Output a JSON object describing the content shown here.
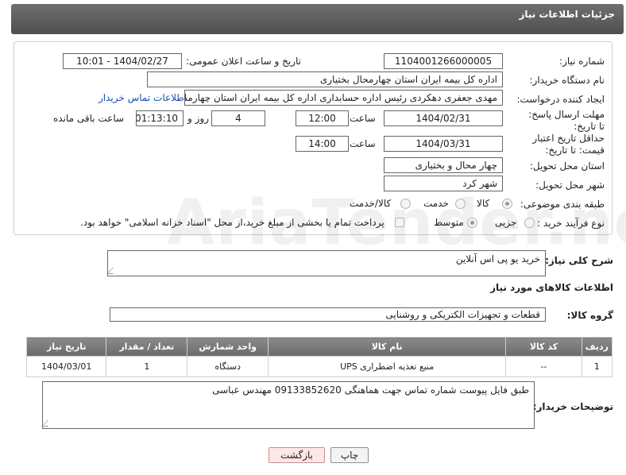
{
  "header": {
    "title": "جزئیات اطلاعات نیاز"
  },
  "form": {
    "need_number": {
      "label": "شماره نیاز:",
      "value": "1104001266000005"
    },
    "announce_datetime": {
      "label": "تاریخ و ساعت اعلان عمومی:",
      "value": "1404/02/27 - 10:01"
    },
    "buyer_org": {
      "label": "نام دستگاه خریدار:",
      "value": "اداره کل بیمه ایران استان چهارمحال بختیاری"
    },
    "requester": {
      "label": "ایجاد کننده درخواست:",
      "value": "مهدی جعفری دهکردی رئیس اداره حسابداری اداره کل بیمه ایران استان چهارمحال",
      "contact_link": "اطلاعات تماس خریدار"
    },
    "reply_deadline": {
      "label": "مهلت ارسال پاسخ: تا تاریخ:",
      "date": "1404/02/31",
      "time_label": "ساعت",
      "time": "12:00",
      "days": "4",
      "days_label": "روز و",
      "remaining": "01:13:10",
      "remaining_label": "ساعت باقی مانده"
    },
    "price_validity": {
      "label": "حداقل تاریخ اعتبار قیمت: تا تاریخ:",
      "date": "1404/03/31",
      "time_label": "ساعت",
      "time": "14:00"
    },
    "delivery_province": {
      "label": "استان محل تحویل:",
      "value": "چهار محال و بختیاری"
    },
    "delivery_city": {
      "label": "شهر محل تحویل:",
      "value": "شهر کرد"
    },
    "category": {
      "label": "طبقه بندی موضوعی:",
      "options": [
        "کالا",
        "خدمت",
        "کالا/خدمت"
      ],
      "selected": "کالا"
    },
    "purchase_type": {
      "label": "نوع فرآیند خرید :",
      "options": [
        "جزیی",
        "متوسط"
      ],
      "selected": "متوسط",
      "payment_note": "پرداخت تمام یا بخشی از مبلغ خرید،از محل \"اسناد خزانه اسلامی\" خواهد بود."
    }
  },
  "summary": {
    "label": "شرح کلی نیاز:",
    "value": "خرید یو پی اس آنلاین"
  },
  "goods_section": {
    "title": "اطلاعات کالاهای مورد نیاز"
  },
  "goods_group": {
    "label": "گروه کالا:",
    "value": "قطعات و تجهیزات الکتریکی و روشنایی"
  },
  "table": {
    "headers": [
      "ردیف",
      "کد کالا",
      "نام کالا",
      "واحد شمارش",
      "تعداد / مقدار",
      "تاریخ نیاز"
    ],
    "rows": [
      [
        "1",
        "--",
        "منبع تغذیه اضطراری UPS",
        "دستگاه",
        "1",
        "1404/03/01"
      ]
    ]
  },
  "buyer_notes": {
    "label": "توضیحات خریدار:",
    "value": "طبق فایل پیوست شماره تماس جهت هماهنگی 09133852620 مهندس عباسی"
  },
  "buttons": {
    "print": "چاپ",
    "back": "بازگشت"
  },
  "watermark": {
    "text": "AriaTender.neT"
  }
}
